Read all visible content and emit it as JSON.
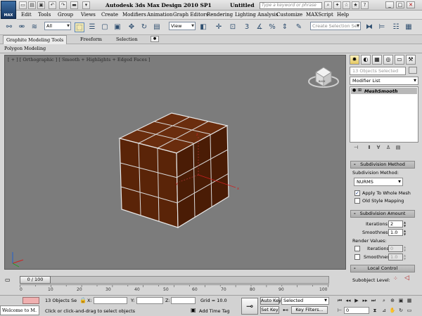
{
  "window": {
    "app_title": "Autodesk 3ds Max Design 2010 SP1",
    "doc_title": "Untitled",
    "logo_text": "MAX",
    "search_placeholder": "Type a keyword or phrase",
    "controls": [
      "_",
      "□",
      "✕"
    ]
  },
  "menu": {
    "items": [
      "Edit",
      "Tools",
      "Group",
      "Views",
      "Create",
      "Modifiers",
      "Animation",
      "Graph Editors",
      "Rendering",
      "Lighting Analysis",
      "Customize",
      "MAXScript",
      "Help"
    ]
  },
  "toolbar": {
    "filter_value": "All",
    "refcoord_value": "View",
    "selection_set_placeholder": "Create Selection Set"
  },
  "ribbon": {
    "tabs": [
      "Graphite Modeling Tools",
      "Freeform",
      "Selection"
    ],
    "panel_label": "Polygon Modeling"
  },
  "viewport": {
    "label": "[ + ] [ Orthographic ] [ Smooth + Highlights + Edged Faces ]",
    "viewcube_text": "BACK",
    "gizmo_axes": [
      "x",
      "y",
      "z"
    ],
    "object_color": "#5a2408"
  },
  "command_panel": {
    "selection_label": "13 Objects Selected",
    "modifier_list": "Modifier List",
    "stack_item": "MeshSmooth",
    "subdivision_method_title": "Subdivision Method",
    "subdivision_method_label": "Subdivision Method:",
    "method_value": "NURMS",
    "apply_whole_mesh": "Apply To Whole Mesh",
    "apply_whole_mesh_checked": true,
    "old_style_mapping": "Old Style Mapping",
    "old_style_mapping_checked": false,
    "subdivision_amount_title": "Subdivision Amount",
    "iterations_label": "Iterations:",
    "iterations_value": "2",
    "smoothness_label": "Smoothness:",
    "smoothness_value": "1.0",
    "render_values_label": "Render Values:",
    "render_iterations_value": "0",
    "render_smoothness_value": "1.0",
    "local_control_title": "Local Control",
    "subobject_level_label": "Subobject Level:"
  },
  "timeline": {
    "slider_label": "0 / 100",
    "ticks": [
      "0",
      "10",
      "20",
      "30",
      "40",
      "50",
      "60",
      "70",
      "80",
      "90",
      "100"
    ]
  },
  "status": {
    "welcome": "Welcome to M.",
    "selection_count": "13 Objects Se",
    "prompt": "Click or click-and-drag to select objects",
    "x_label": "X:",
    "y_label": "Y:",
    "z_label": "Z:",
    "grid": "Grid = 10.0",
    "add_time_tag": "Add Time Tag",
    "auto_key": "Auto Key",
    "set_key": "Set Key",
    "key_mode_value": "Selected",
    "key_filters": "Key Filters...",
    "frame_value": "0"
  }
}
